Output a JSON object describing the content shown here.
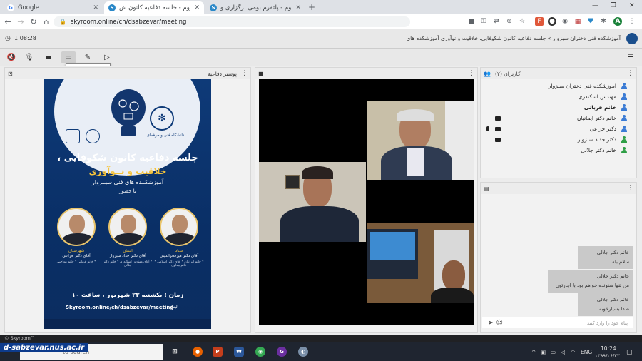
{
  "browser": {
    "tabs": [
      {
        "label": "Google",
        "active": false
      },
      {
        "label": "اسکای‌روم - جلسه دفاعیه کانون ش...",
        "active": true
      },
      {
        "label": "اسکای‌روم - پلتفرم بومی برگزاری و...",
        "active": false
      }
    ],
    "url": "skyroom.online/ch/dsabzevar/meeting",
    "profile_initial": "A"
  },
  "app": {
    "timer": "1:08:28",
    "title": "آموزشکده فنی دختران سبزوار » جلسه دفاعیه کانون شکوفایی، خلاقیت و نوآوری آموزشکده های سبزوار",
    "tooltip": "اشتراک دسکتاپ"
  },
  "panels": {
    "poster_header": "پوستر دفاعیه",
    "users_header": "کاربران (۲)",
    "video_header": ""
  },
  "poster": {
    "org": "دانشگاه فنی و حرفه‌ای",
    "title_line1": "جلسه دفاعیه کانون شکوفایی ،",
    "title_line2": "خلاقیت و نــوآوری",
    "title_line3": "آموزشکــده های فنی سبــزوار",
    "title_line4": "با حضور",
    "people": [
      {
        "role": "شهرستان",
        "name": "آقای دکتر خزاعی",
        "sub": "* خانم قربانی  * خانم بیداجبی"
      },
      {
        "role": "استان",
        "name": "آقای دکتر جداد سبزوار",
        "sub": "* آقای مهندس اسکندری  * خانم دکتر جلالی"
      },
      {
        "role": "ستاد",
        "name": "آقای دکتر میرفخرالدینی",
        "sub": "* خانم ایرانیان  * آقای دکتر اسلامی  * خانم بیداوی"
      }
    ],
    "date": "زمان : یکشنبه ۲۳ شهریور ، ساعت ۱۰",
    "link": "Skyroom.online/ch/dsabzevar/meeting",
    "link_label": "لینک :"
  },
  "users": [
    {
      "name": "آموزشکده فنی دختران سبزوار",
      "color": "#3a7bd5",
      "bold": false,
      "cam": false,
      "mic": false
    },
    {
      "name": "مهندس اسکندری",
      "color": "#3a7bd5",
      "bold": false,
      "cam": false,
      "mic": false
    },
    {
      "name": "خانم قربانی",
      "color": "#3a7bd5",
      "bold": true,
      "cam": false,
      "mic": false
    },
    {
      "name": "خانم دکتر ایمانیان",
      "color": "#3a7bd5",
      "bold": false,
      "cam": true,
      "mic": false
    },
    {
      "name": "دکتر خزاعی",
      "color": "#3a7bd5",
      "bold": false,
      "cam": true,
      "mic": true
    },
    {
      "name": "دکتر جداد سبزوار",
      "color": "#2e9e45",
      "bold": false,
      "cam": true,
      "mic": false
    },
    {
      "name": "خانم دکتر جلالی",
      "color": "#2e9e45",
      "bold": false,
      "cam": false,
      "mic": false
    }
  ],
  "chat": {
    "messages": [
      {
        "sender": "خانم دکتر جلالی",
        "text": "سلام بله"
      },
      {
        "sender": "خانم دکتر جلالی",
        "text": "من تنها شنونده خواهم بود با اجازتون"
      },
      {
        "sender": "خانم دکتر جلالی",
        "text": "صدا بسیارخوبه"
      }
    ],
    "placeholder": "پیام خود را وارد کنید"
  },
  "footer": {
    "brand": "© Skyroom™",
    "watermark": "d-sabzevar.nus.ac.ir",
    "search_placeholder": "to search",
    "time": "10:24",
    "date": "۱۳۹۹/۰۶/۲۳",
    "lang": "ENG"
  }
}
